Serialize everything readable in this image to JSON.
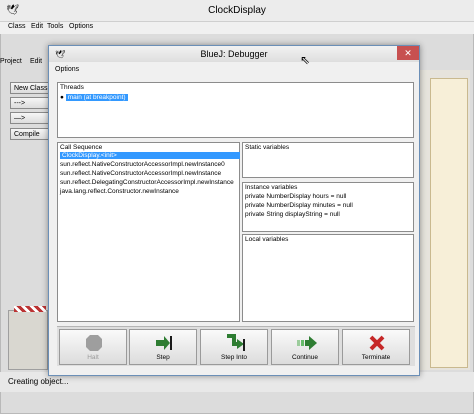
{
  "main_window": {
    "title": "ClockDisplay",
    "menu": [
      "Class",
      "Edit",
      "Tools",
      "Options"
    ],
    "side_menu": [
      "Project",
      "Edit"
    ],
    "toolbar": {
      "new_class": "New Class...",
      "arrow_dashed": "--->",
      "arrow_solid": "—>",
      "compile": "Compile"
    },
    "status": "Creating object..."
  },
  "debugger": {
    "title": "BlueJ:  Debugger",
    "menu_options": "Options",
    "threads_label": "Threads",
    "threads": [
      "main (at breakpoint)"
    ],
    "call_sequence_label": "Call Sequence",
    "call_sequence": [
      "ClockDisplay.<init>",
      "sun.reflect.NativeConstructorAccessorImpl.newInstance0",
      "sun.reflect.NativeConstructorAccessorImpl.newInstance",
      "sun.reflect.DelegatingConstructorAccessorImpl.newInstance",
      "java.lang.reflect.Constructor.newInstance"
    ],
    "static_variables_label": "Static variables",
    "instance_variables_label": "Instance variables",
    "instance_variables": [
      "private NumberDisplay hours = null",
      "private NumberDisplay minutes = null",
      "private String displayString = null"
    ],
    "local_variables_label": "Local variables",
    "buttons": {
      "halt": "Halt",
      "step": "Step",
      "step_into": "Step Into",
      "continue": "Continue",
      "terminate": "Terminate"
    },
    "close_symbol": "✕"
  },
  "colors": {
    "selection": "#3399ff",
    "close_button": "#c75050",
    "step_green": "#2e7d32",
    "terminate_red": "#c62828"
  }
}
